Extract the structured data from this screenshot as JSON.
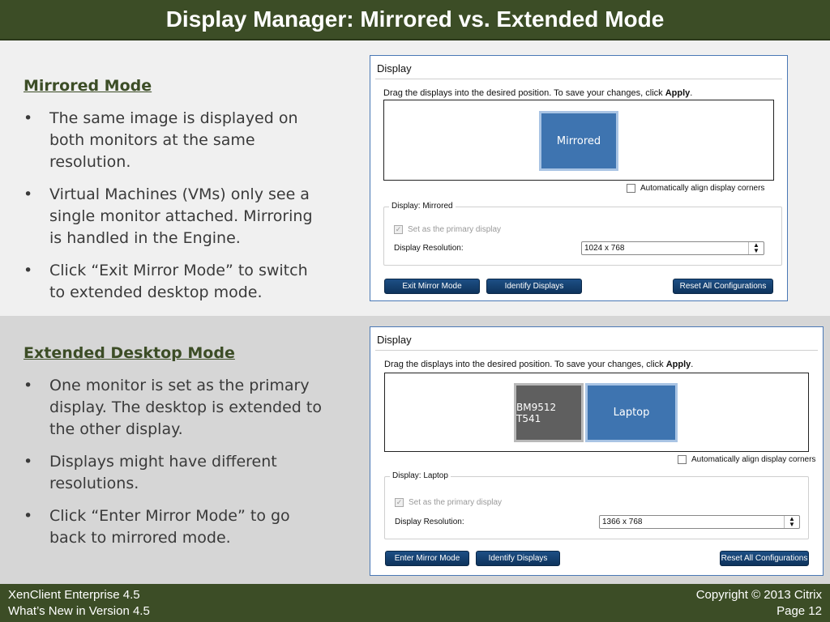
{
  "slide": {
    "title": "Display Manager: Mirrored vs. Extended Mode"
  },
  "mirrored_section": {
    "heading": "Mirrored Mode",
    "bullets": [
      "The same image is displayed on both monitors at the same resolution.",
      "Virtual Machines (VMs) only see a single monitor attached.  Mirroring is handled in the Engine.",
      "Click “Exit Mirror Mode” to switch to extended desktop mode."
    ]
  },
  "extended_section": {
    "heading": "Extended Desktop Mode",
    "bullets": [
      "One monitor is set as the primary display.  The desktop is extended to the other display.",
      " Displays might have different resolutions.",
      "Click “Enter Mirror Mode” to go back to mirrored mode."
    ]
  },
  "bullet_glyph": "•",
  "dialog_mirrored": {
    "title": "Display",
    "instruction_prefix": "Drag the displays into the desired position. To save your changes, click ",
    "instruction_apply": "Apply",
    "instruction_suffix": ".",
    "monitors": [
      "Mirrored"
    ],
    "align_label": "Automatically align display corners",
    "group_legend": "Display: Mirrored",
    "primary_label": "Set as the primary display",
    "resolution_label": "Display Resolution:",
    "resolution_value": "1024 x 768",
    "buttons": {
      "mirror": "Exit Mirror Mode",
      "identify": "Identify Displays",
      "reset": "Reset All Configurations"
    }
  },
  "dialog_extended": {
    "title": "Display",
    "instruction_prefix": "Drag the displays into the desired position. To save your changes, click ",
    "instruction_apply": "Apply",
    "instruction_suffix": ".",
    "monitors": [
      "BM9512 T541",
      "Laptop"
    ],
    "align_label": "Automatically align display corners",
    "group_legend": "Display: Laptop",
    "primary_label": "Set as the primary display",
    "resolution_label": "Display Resolution:",
    "resolution_value": "1366 x 768",
    "buttons": {
      "mirror": "Enter Mirror Mode",
      "identify": "Identify Displays",
      "reset": "Reset All Configurations"
    }
  },
  "footer": {
    "product": "XenClient Enterprise 4.5",
    "subtitle": "What’s New in Version 4.5",
    "copyright": "Copyright © 2013 Citrix",
    "page": "Page 12"
  },
  "colors": {
    "brand_green": "#3c4d26",
    "button_blue": "#1d4f85",
    "monitor_blue": "#3e74b0"
  }
}
